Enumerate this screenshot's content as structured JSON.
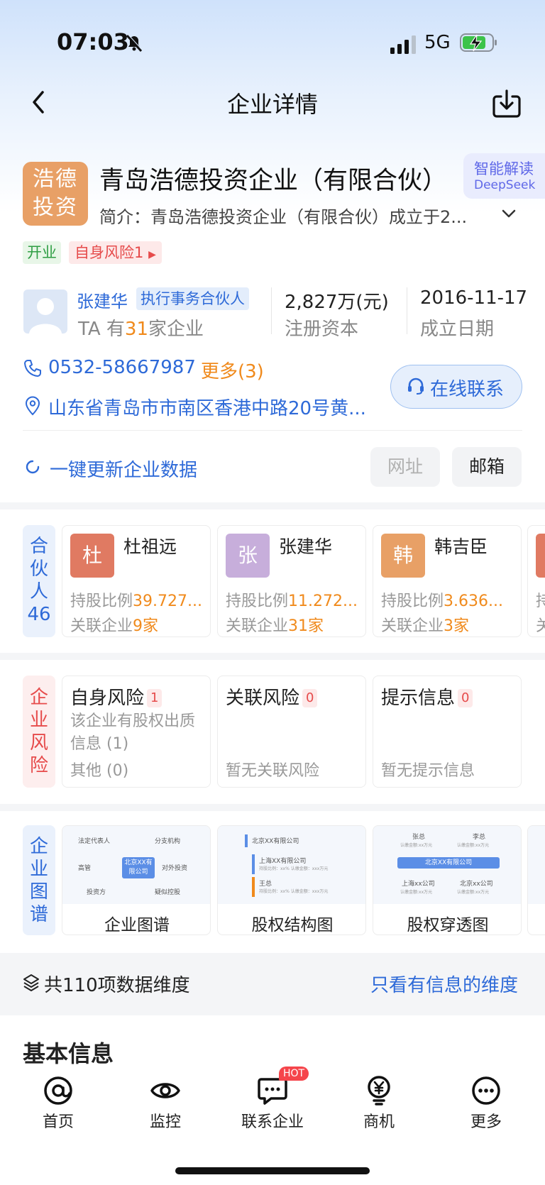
{
  "status_bar": {
    "time": "07:03",
    "network": "5G"
  },
  "nav": {
    "title": "企业详情"
  },
  "company": {
    "logo_line1": "浩德",
    "logo_line2": "投资",
    "name": "青岛浩德投资企业（有限合伙）",
    "intro": "简介：青岛浩德投资企业（有限合伙）成立于2...",
    "ai_badge_line1": "智能解读",
    "ai_badge_line2": "DeepSeek",
    "tags": {
      "status": "开业",
      "risk": "自身风险1"
    }
  },
  "legal": {
    "name": "张建华",
    "role": "执行事务合伙人",
    "ta_prefix": "TA 有",
    "ta_count": "31",
    "ta_suffix": "家企业"
  },
  "stats": {
    "capital_value": "2,827万(元)",
    "capital_label": "注册资本",
    "date_value": "2016-11-17",
    "date_label": "成立日期"
  },
  "contact": {
    "phone": "0532-58667987",
    "more": "更多(3)",
    "address": "山东省青岛市市南区香港中路20号黄...",
    "online_btn": "在线联系"
  },
  "update": {
    "label": "一键更新企业数据",
    "url_btn": "网址",
    "mail_btn": "邮箱"
  },
  "partners": {
    "side_label": "合伙人",
    "count": "46",
    "items": [
      {
        "avatar": "杜",
        "name": "杜祖远",
        "ratio_label": "持股比例",
        "ratio": "39.727...",
        "rel_label": "关联企业",
        "rel": "9家",
        "color": "#e07a62"
      },
      {
        "avatar": "张",
        "name": "张建华",
        "ratio_label": "持股比例",
        "ratio": "11.272...",
        "rel_label": "关联企业",
        "rel": "31家",
        "color": "#c7aedb"
      },
      {
        "avatar": "韩",
        "name": "韩吉臣",
        "ratio_label": "持股比例",
        "ratio": "3.636...",
        "rel_label": "关联企业",
        "rel": "3家",
        "color": "#e8a066"
      }
    ],
    "partial_first": "持",
    "partial_second": "关"
  },
  "risk": {
    "side_label": "企业风险",
    "items": [
      {
        "title": "自身风险",
        "count": "1",
        "line1": "该企业有股权出质",
        "line2": "信息 (1)",
        "line3": "其他 (0)"
      },
      {
        "title": "关联风险",
        "count": "0",
        "line1": "暂无关联风险"
      },
      {
        "title": "提示信息",
        "count": "0",
        "line1": "暂无提示信息"
      }
    ]
  },
  "graph": {
    "side_label": "企业图谱",
    "items": [
      {
        "title": "企业图谱"
      },
      {
        "title": "股权结构图"
      },
      {
        "title": "股权穿透图"
      }
    ],
    "thumb1": {
      "center": "北京XX有限公司",
      "nodes": [
        "法定代表人",
        "分支机构",
        "高管",
        "对外投资",
        "投资方",
        "疑似控股"
      ]
    },
    "thumb2": {
      "top": "北京XX有限公司",
      "mid": "上海XX有限公司",
      "mid_sub": "持股比例：xx%  认缴金额：xxx万元",
      "low": "王总",
      "low_sub": "持股比例：xx%  认缴金额：xxx万元"
    },
    "thumb3": {
      "top_left": "张总",
      "top_right": "李总",
      "top_sub": "认缴金额:xx万元",
      "center": "北京XX有限公司",
      "bottom_left": "上海xx公司",
      "bottom_right": "北京xx公司",
      "bottom_sub": "认缴金额:xx万元"
    }
  },
  "dimensions": {
    "total": "共110项数据维度",
    "filter_link": "只看有信息的维度"
  },
  "basic_info": {
    "title": "基本信息"
  },
  "tabbar": {
    "items": [
      {
        "label": "首页",
        "icon": "at-icon"
      },
      {
        "label": "监控",
        "icon": "eye-icon"
      },
      {
        "label": "联系企业",
        "icon": "chat-icon"
      },
      {
        "label": "商机",
        "icon": "yen-bulb-icon"
      },
      {
        "label": "更多",
        "icon": "more-dots-icon"
      }
    ],
    "hot_badge": "HOT"
  },
  "colors": {
    "brand_blue": "#2e6ad8",
    "orange": "#f08a1c",
    "risk_red": "#e64b4b",
    "green": "#2f9e44"
  }
}
